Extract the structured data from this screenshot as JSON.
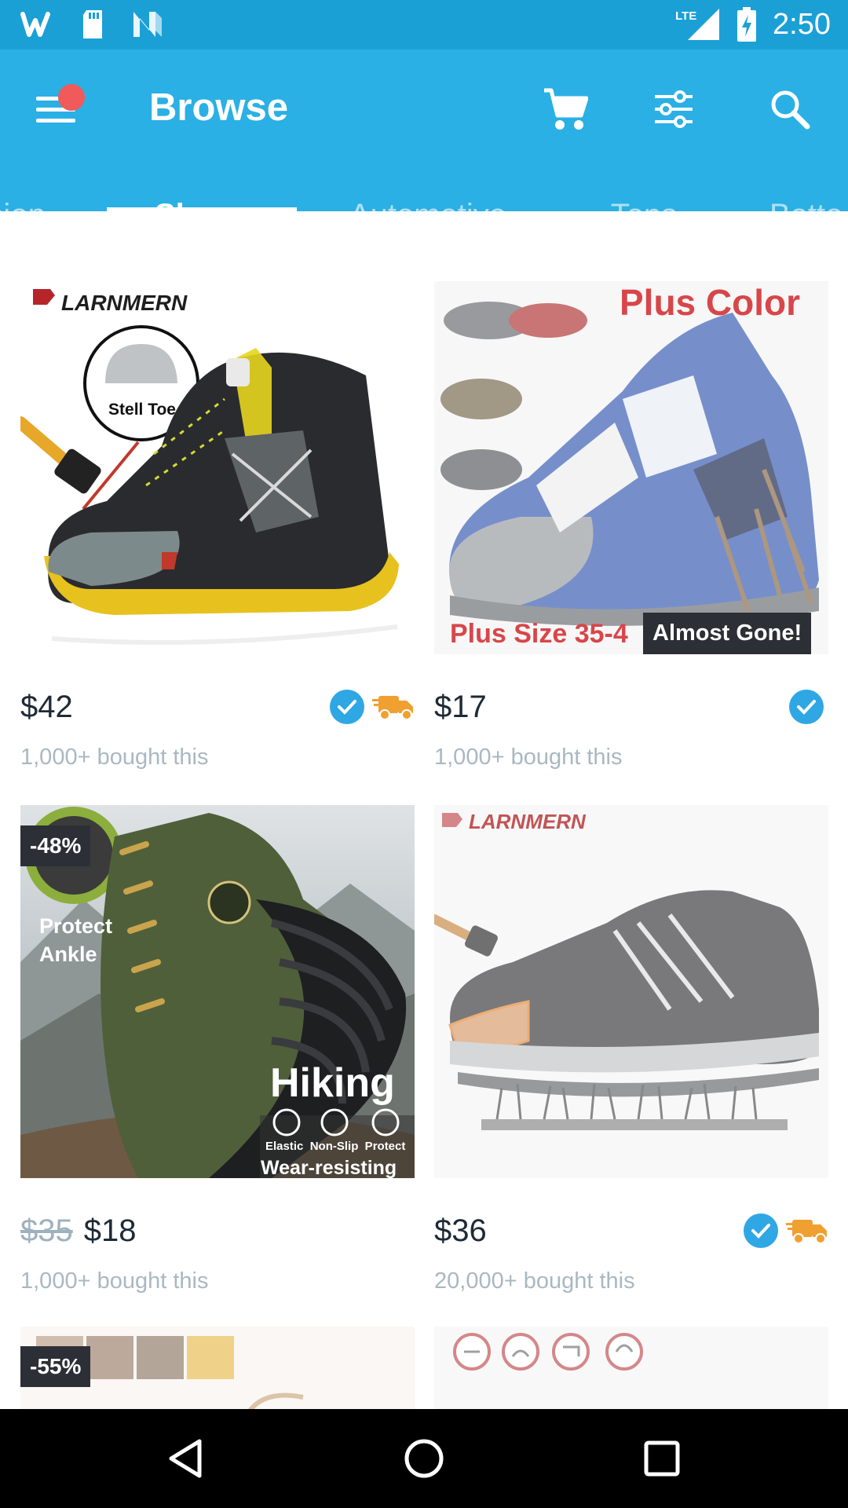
{
  "status_bar": {
    "time": "2:50",
    "network_label": "LTE",
    "icons": [
      "wish-logo-icon",
      "sd-card-icon",
      "n-notification-icon",
      "signal-icon",
      "battery-icon"
    ]
  },
  "app_bar": {
    "title": "Browse",
    "accent_color": "#2ab0e4",
    "notification_dot_color": "#f05a5a",
    "actions": [
      "cart-icon",
      "filter-icon",
      "search-icon"
    ]
  },
  "tabs": {
    "items": [
      {
        "label": "hion"
      },
      {
        "label": "Shoes",
        "active": true
      },
      {
        "label": "Automotive"
      },
      {
        "label": "Tops"
      },
      {
        "label": "Botto"
      }
    ]
  },
  "products": [
    {
      "brand": "LARNMERN",
      "image_label": "Stell Toe",
      "price": "$42",
      "bought": "1,000+ bought this",
      "verified": true,
      "fast_shipping": true
    },
    {
      "image_label_top": "Plus Color",
      "image_label_bottom": "Plus Size 35-4",
      "tag": "Almost Gone!",
      "price": "$17",
      "bought": "1,000+ bought this",
      "verified": true,
      "fast_shipping": false
    },
    {
      "discount": "-48%",
      "image_label_left": "Protect\nAnkle",
      "image_label_main": "Hiking",
      "image_label_features": "Elastic  Non-Slip  Protect",
      "image_label_bottom": "Wear-resisting",
      "old_price": "$35",
      "price": "$18",
      "bought": "1,000+ bought this",
      "verified": false,
      "fast_shipping": false
    },
    {
      "brand": "LARNMERN",
      "price": "$36",
      "bought": "20,000+ bought this",
      "verified": true,
      "fast_shipping": true
    },
    {
      "discount": "-55%"
    },
    {}
  ],
  "nav_bar": {
    "buttons": [
      "back-icon",
      "home-icon",
      "recents-icon"
    ]
  }
}
